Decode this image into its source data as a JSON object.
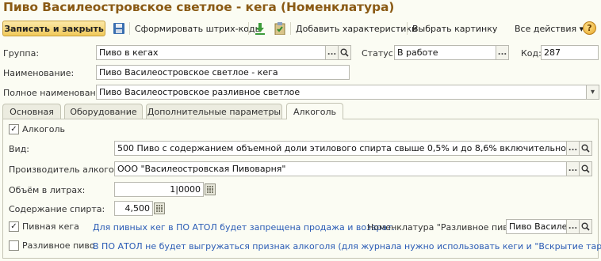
{
  "window": {
    "title": "Пиво Василеостровское светлое - кега (Номенклатура)"
  },
  "toolbar": {
    "save_close": "Записать и закрыть",
    "barcodes": "Сформировать штрих-коды",
    "add_characteristics": "Добавить характеристики",
    "choose_picture": "Выбрать картинку",
    "all_actions": "Все действия",
    "help": "?"
  },
  "form": {
    "group_label": "Группа:",
    "group_value": "Пиво в кегах",
    "status_label": "Статус:",
    "status_value": "В работе",
    "code_label": "Код:",
    "code_value": "287",
    "name_label": "Наименование:",
    "name_value": "Пиво Василеостровское светлое - кега",
    "full_name_label": "Полное наименование:",
    "full_name_value": "Пиво Василеостровское разливное светлое"
  },
  "tabs": [
    {
      "label": "Основная"
    },
    {
      "label": "Оборудование"
    },
    {
      "label": "Дополнительные параметры"
    },
    {
      "label": "Алкоголь"
    }
  ],
  "alcohol": {
    "alcohol_checkbox_label": "Алкоголь",
    "alcohol_checked": true,
    "kind_label": "Вид:",
    "kind_value": "500 Пиво с содержанием объемной доли этилового спирта свыше 0,5% и до 8,6% включительно",
    "producer_label": "Производитель алкоголя:",
    "producer_value": "ООО \"Василеостровская Пивоварня\"",
    "volume_label": "Объём в литрах:",
    "volume_value": "1,0000",
    "volume_display": "1|0000",
    "strength_label": "Содержание  спирта:",
    "strength_value": "4,500",
    "keg_label": "Пивная кега",
    "keg_checked": true,
    "keg_note": "Для пивных кег в ПО АТОЛ  будет запрещена продажа и возврат.",
    "draft_nomenclature_label": "Номенклатура \"Разливное пиво\":",
    "draft_nomenclature_value": "Пиво Василео",
    "draft_label": "Разливное пиво",
    "draft_checked": false,
    "draft_note": "В ПО АТОЛ не будет выгружаться признак алкоголя (для журнала нужно использовать кеги и \"Вскрытие тары\")"
  },
  "glyphs": {
    "ellipsis": "...",
    "check": "✓",
    "dropdown": "▾"
  }
}
